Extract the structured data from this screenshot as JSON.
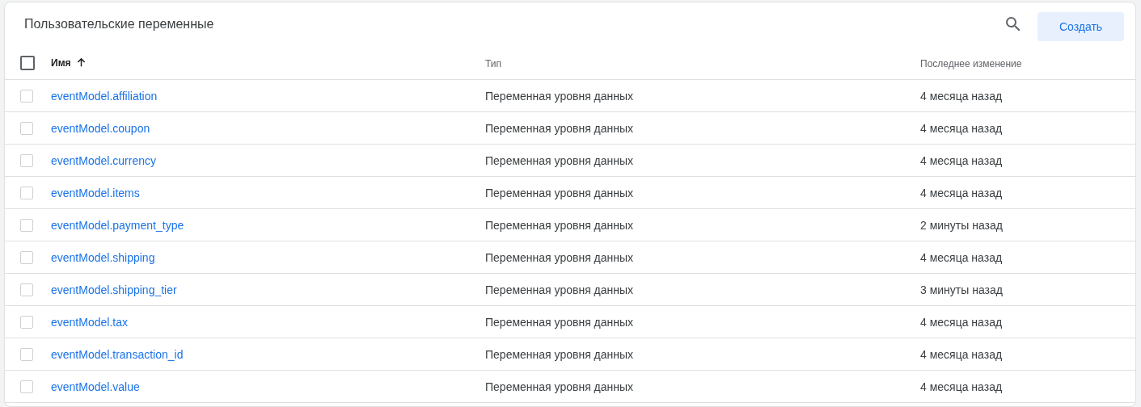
{
  "title": "Пользовательские переменные",
  "create_button": "Создать",
  "table": {
    "select_all": {
      "checked": false
    },
    "columns": [
      {
        "label": "Имя",
        "sorted": true
      },
      {
        "label": "Тип",
        "sorted": false
      },
      {
        "label": "Последнее изменение",
        "sorted": false
      }
    ],
    "rows": [
      {
        "name": "eventModel.affiliation",
        "type": "Переменная уровня данных",
        "modified": "4 месяца назад",
        "checked": false
      },
      {
        "name": "eventModel.coupon",
        "type": "Переменная уровня данных",
        "modified": "4 месяца назад",
        "checked": false
      },
      {
        "name": "eventModel.currency",
        "type": "Переменная уровня данных",
        "modified": "4 месяца назад",
        "checked": false
      },
      {
        "name": "eventModel.items",
        "type": "Переменная уровня данных",
        "modified": "4 месяца назад",
        "checked": false
      },
      {
        "name": "eventModel.payment_type",
        "type": "Переменная уровня данных",
        "modified": "2 минуты назад",
        "checked": false
      },
      {
        "name": "eventModel.shipping",
        "type": "Переменная уровня данных",
        "modified": "4 месяца назад",
        "checked": false
      },
      {
        "name": "eventModel.shipping_tier",
        "type": "Переменная уровня данных",
        "modified": "3 минуты назад",
        "checked": false
      },
      {
        "name": "eventModel.tax",
        "type": "Переменная уровня данных",
        "modified": "4 месяца назад",
        "checked": false
      },
      {
        "name": "eventModel.transaction_id",
        "type": "Переменная уровня данных",
        "modified": "4 месяца назад",
        "checked": false
      },
      {
        "name": "eventModel.value",
        "type": "Переменная уровня данных",
        "modified": "4 месяца назад",
        "checked": false
      }
    ]
  }
}
